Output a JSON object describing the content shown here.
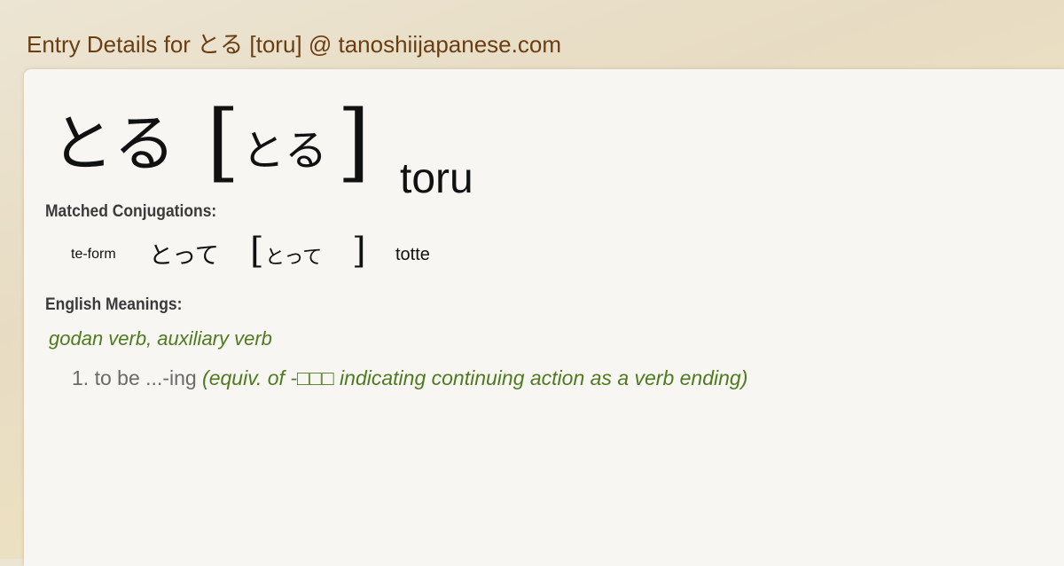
{
  "page": {
    "header_title": "Entry Details for とる [toru] @ tanoshiijapanese.com"
  },
  "entry": {
    "word": "とる",
    "reading": "とる",
    "bracket_open": "[",
    "bracket_close": "]",
    "romaji": "toru"
  },
  "conjugations": {
    "label": "Matched Conjugations:",
    "items": [
      {
        "type": "te-form",
        "kana": "とって",
        "reading": "とって",
        "romaji": "totte"
      }
    ]
  },
  "meanings": {
    "label": "English Meanings:",
    "part_of_speech": "godan verb, auxiliary verb",
    "senses": [
      {
        "number": "1.",
        "gloss": "to be ...-ing",
        "note": "(equiv. of -□□□ indicating continuing action as a verb ending)"
      }
    ]
  },
  "colors": {
    "header_text": "#6b3e12",
    "pos_green": "#4f7a1f",
    "card_bg": "#f7f6f2"
  }
}
